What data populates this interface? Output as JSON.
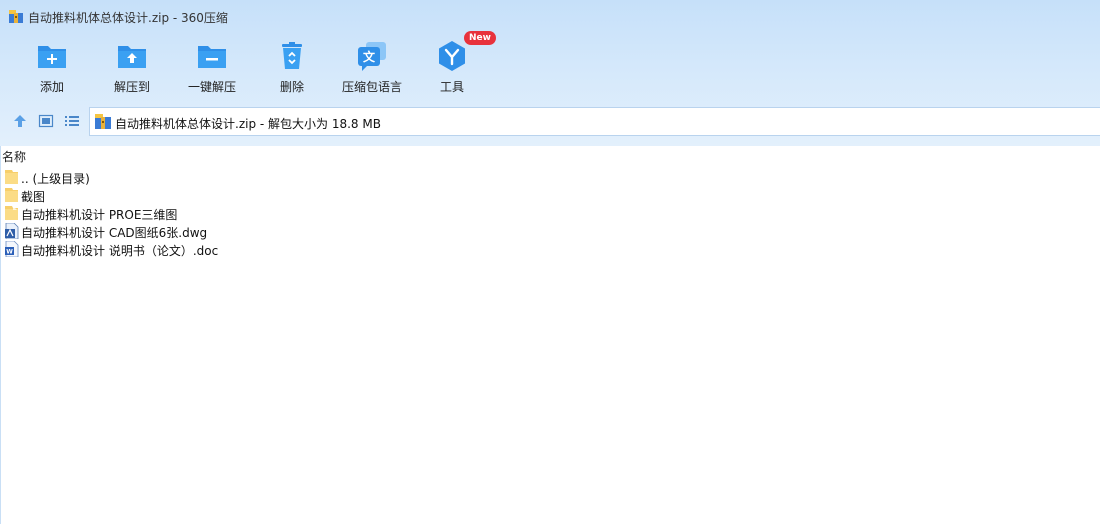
{
  "window": {
    "title": "自动推料机体总体设计.zip - 360压缩"
  },
  "toolbar": {
    "buttons": [
      {
        "label": "添加",
        "icon": "add-folder-icon"
      },
      {
        "label": "解压到",
        "icon": "extract-folder-icon"
      },
      {
        "label": "一键解压",
        "icon": "one-click-extract-icon"
      },
      {
        "label": "删除",
        "icon": "recycle-bin-icon"
      },
      {
        "label": "压缩包语言",
        "icon": "language-icon"
      },
      {
        "label": "工具",
        "icon": "tools-icon",
        "badge": "New"
      }
    ]
  },
  "nav": {
    "address": "自动推料机体总体设计.zip - 解包大小为 18.8 MB",
    "icons": [
      "up-arrow-icon",
      "thumbnail-view-icon",
      "list-view-icon"
    ]
  },
  "list": {
    "header": "名称",
    "files": [
      {
        "name": ".. (上级目录)",
        "type": "folder"
      },
      {
        "name": "截图",
        "type": "folder"
      },
      {
        "name": "自动推料机设计 PROE三维图",
        "type": "folder"
      },
      {
        "name": "自动推料机设计 CAD图纸6张.dwg",
        "type": "dwg"
      },
      {
        "name": "自动推料机设计 说明书（论文）.doc",
        "type": "doc"
      }
    ]
  },
  "colors": {
    "accent": "#2b8be6",
    "chrome_top": "#c6e0f9",
    "badge": "#e8323c",
    "folder": "#f7cf6b"
  }
}
